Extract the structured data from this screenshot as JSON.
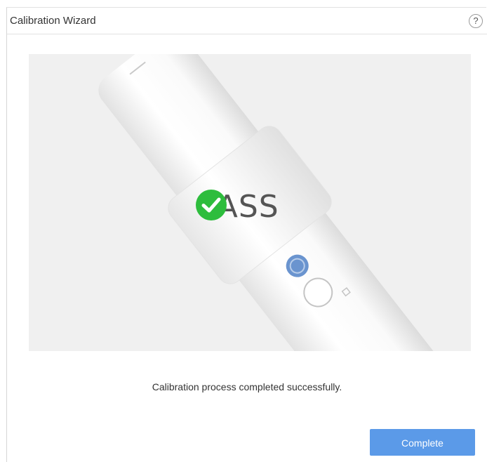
{
  "window": {
    "title": "Calibration Wizard",
    "help_label": "?"
  },
  "result": {
    "status_label": "PASS",
    "status_icon": "check-circle-icon",
    "status_color": "#2ebd3d"
  },
  "message": "Calibration process completed successfully.",
  "footer": {
    "complete_label": "Complete",
    "accent_color": "#5b9ae8"
  }
}
